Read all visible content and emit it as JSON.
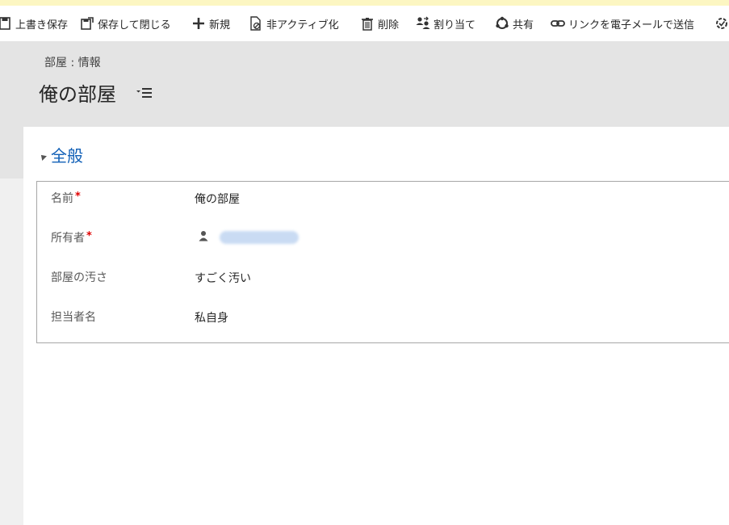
{
  "commandbar": {
    "items": [
      {
        "label": "上書き保存",
        "icon": "save-icon"
      },
      {
        "label": "保存して閉じる",
        "icon": "save-close-icon"
      },
      {
        "label": "新規",
        "icon": "plus-icon"
      },
      {
        "label": "非アクティブ化",
        "icon": "deactivate-icon"
      },
      {
        "label": "削除",
        "icon": "trash-icon"
      },
      {
        "label": "割り当て",
        "icon": "assign-icon"
      },
      {
        "label": "共有",
        "icon": "share-icon"
      },
      {
        "label": "リンクを電子メールで送信",
        "icon": "link-icon"
      },
      {
        "label": "",
        "icon": "workflow-icon"
      }
    ]
  },
  "header": {
    "entity_type": "部屋 : 情報",
    "record_title": "俺の部屋",
    "menu_icon": "form-selector-icon"
  },
  "section": {
    "title": "全般",
    "collapse_icon": "collapse-triangle-icon"
  },
  "fields": [
    {
      "label": "名前",
      "required_mark": "*",
      "value": "俺の部屋"
    },
    {
      "label": "所有者",
      "required_mark": "*",
      "value": "",
      "icon": "user-icon",
      "value_redacted": true
    },
    {
      "label": "部屋の汚さ",
      "required_mark": "",
      "value": "すごく汚い"
    },
    {
      "label": "担当者名",
      "required_mark": "",
      "value": "私自身"
    }
  ],
  "colors": {
    "accent": "#1160b7",
    "required": "#e00000",
    "header_band": "#e4e4e4",
    "top_strip": "#fcf6c2"
  }
}
